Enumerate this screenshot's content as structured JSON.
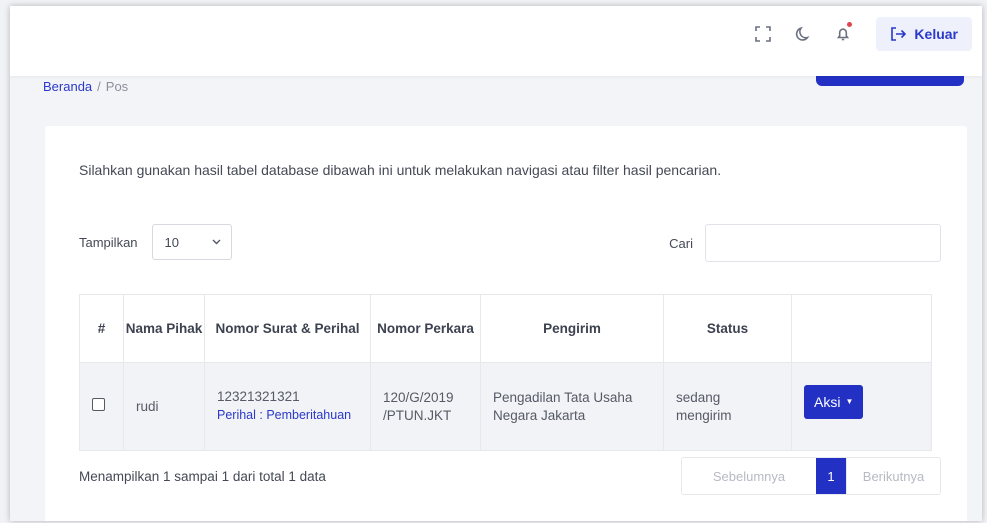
{
  "header": {
    "logout_label": "Keluar"
  },
  "breadcrumb": {
    "home": "Beranda",
    "separator": "/",
    "current": "Pos"
  },
  "card": {
    "intro": "Silahkan gunakan hasil tabel database dibawah ini untuk melakukan navigasi atau filter hasil pencarian.",
    "length_label": "Tampilkan",
    "length_value": "10",
    "search_label": "Cari",
    "search_value": ""
  },
  "table": {
    "headers": {
      "num": "#",
      "nama_pihak": "Nama Pihak",
      "nomor_surat": "Nomor Surat & Perihal",
      "nomor_perkara": "Nomor Perkara",
      "pengirim": "Pengirim",
      "status": "Status",
      "actions": ""
    },
    "rows": [
      {
        "nama_pihak": "rudi",
        "nomor_surat": "12321321321",
        "perihal": "Perihal : Pemberitahuan",
        "nomor_perkara": "120/G/2019 /PTUN.JKT",
        "pengirim": "Pengadilan Tata Usaha Negara Jakarta",
        "status": "sedang mengirim",
        "action_label": "Aksi"
      }
    ]
  },
  "footer": {
    "info": "Menampilkan 1 sampai 1 dari total 1 data",
    "prev": "Sebelumnya",
    "page": "1",
    "next": "Berikutnya"
  },
  "colors": {
    "primary": "#2231c4",
    "link": "#2a39c9",
    "notification_dot": "#e0454f"
  }
}
